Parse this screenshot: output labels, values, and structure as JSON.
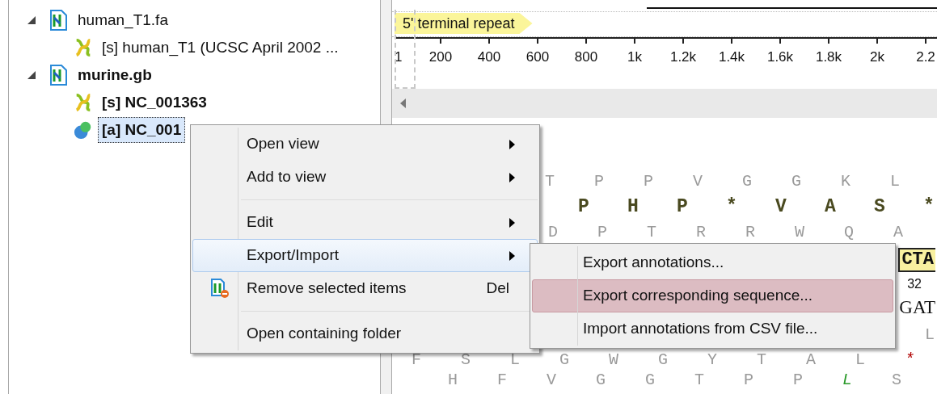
{
  "tree": [
    {
      "kind": "file",
      "label": "human_T1.fa",
      "expanded": true,
      "bold": false,
      "selected": false,
      "children": [
        {
          "kind": "sequence",
          "label": "[s] human_T1 (UCSC April 2002 ...",
          "bold": false,
          "selected": false
        }
      ]
    },
    {
      "kind": "file",
      "label": "murine.gb",
      "expanded": true,
      "bold": true,
      "selected": false,
      "children": [
        {
          "kind": "sequence",
          "label": "[s] NC_001363",
          "bold": true,
          "selected": false
        },
        {
          "kind": "annotation",
          "label": "[a] NC_001",
          "bold": true,
          "selected": true
        }
      ]
    }
  ],
  "annotation_track": {
    "label": "5' terminal repeat"
  },
  "ruler": {
    "labels": [
      "1",
      "200",
      "400",
      "600",
      "800",
      "1k",
      "1.2k",
      "1.4k",
      "1.6k",
      "1.8k",
      "2k",
      "2.2"
    ]
  },
  "sequence_rows": [
    {
      "kind": "frame",
      "letters": [
        {
          "text": "T"
        },
        {
          "text": "P"
        },
        {
          "text": "P"
        },
        {
          "text": "V"
        },
        {
          "text": "G"
        },
        {
          "text": "G"
        },
        {
          "text": "K"
        },
        {
          "text": "L"
        }
      ]
    },
    {
      "kind": "strong",
      "letters": [
        {
          "text": "P"
        },
        {
          "text": "H"
        },
        {
          "text": "P"
        },
        {
          "text": "*"
        },
        {
          "text": "V"
        },
        {
          "text": "A"
        },
        {
          "text": "S"
        },
        {
          "text": "*"
        }
      ]
    },
    {
      "kind": "frame",
      "letters": [
        {
          "text": "D"
        },
        {
          "text": "P"
        },
        {
          "text": "T"
        },
        {
          "text": "R"
        },
        {
          "text": "R"
        },
        {
          "text": "W"
        },
        {
          "text": "Q"
        },
        {
          "text": "A"
        }
      ]
    },
    {
      "kind": "highlight",
      "letters": [
        {
          "text": "CTA"
        }
      ]
    },
    {
      "kind": "position",
      "letters": [
        {
          "text": "32"
        }
      ]
    },
    {
      "kind": "bases",
      "letters": [
        {
          "text": "GAT"
        }
      ]
    },
    {
      "kind": "edge",
      "letters": [
        {
          "text": "L"
        }
      ]
    },
    {
      "kind": "frame",
      "letters": [
        {
          "text": "F"
        },
        {
          "text": "S"
        },
        {
          "text": "L"
        },
        {
          "text": "G"
        },
        {
          "text": "W"
        },
        {
          "text": "G"
        },
        {
          "text": "Y"
        },
        {
          "text": "T"
        },
        {
          "text": "A"
        },
        {
          "text": "L"
        },
        {
          "text": "*",
          "color": "#b00000"
        }
      ]
    },
    {
      "kind": "frame",
      "letters": [
        {
          "text": "H"
        },
        {
          "text": "F"
        },
        {
          "text": "V"
        },
        {
          "text": "G"
        },
        {
          "text": "G"
        },
        {
          "text": "T"
        },
        {
          "text": "P"
        },
        {
          "text": "P"
        },
        {
          "text": "L",
          "color": "#2a9a2a"
        },
        {
          "text": "S"
        }
      ]
    }
  ],
  "context_menu": {
    "items": [
      {
        "label": "Open view",
        "submenu": true,
        "separator_before": false,
        "selected": false
      },
      {
        "label": "Add to view",
        "submenu": true,
        "separator_before": false,
        "selected": false
      },
      {
        "label": "Edit",
        "submenu": true,
        "separator_before": true,
        "selected": false
      },
      {
        "label": "Export/Import",
        "submenu": true,
        "separator_before": false,
        "selected": true
      },
      {
        "label": "Remove selected items",
        "submenu": false,
        "separator_before": false,
        "selected": false,
        "icon": true,
        "shortcut": "Del"
      },
      {
        "label": "Open containing folder",
        "submenu": false,
        "separator_before": true,
        "selected": false
      }
    ]
  },
  "submenu": {
    "items": [
      {
        "label": "Export annotations...",
        "selected": false
      },
      {
        "label": "Export corresponding sequence...",
        "selected": true
      },
      {
        "label": "Import annotations from CSV file...",
        "selected": false
      }
    ]
  }
}
